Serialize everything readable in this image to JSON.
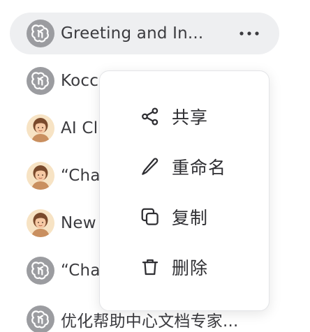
{
  "chats": [
    {
      "title": "Greeting and In...",
      "avatar": "chatgpt-logo-icon",
      "active": true
    },
    {
      "title": "Kocc",
      "avatar": "chatgpt-logo-icon",
      "active": false
    },
    {
      "title": "AI Cl",
      "avatar": "persona-avatar-icon",
      "active": false
    },
    {
      "title": "“Cha",
      "avatar": "persona-avatar-icon",
      "active": false
    },
    {
      "title": "New",
      "avatar": "persona-avatar-icon",
      "active": false
    },
    {
      "title": "“Cha",
      "avatar": "chatgpt-logo-icon",
      "active": false
    },
    {
      "title": "优化帮助中心文档专家...",
      "avatar": "chatgpt-logo-icon",
      "active": false
    }
  ],
  "more_icon": "ellipsis-icon",
  "context_menu": {
    "items": [
      {
        "label": "共享",
        "icon": "share-icon"
      },
      {
        "label": "重命名",
        "icon": "pencil-icon"
      },
      {
        "label": "复制",
        "icon": "copy-icon"
      },
      {
        "label": "删除",
        "icon": "trash-icon"
      }
    ]
  },
  "colors": {
    "active_row_bg": "#eeeff1",
    "gpt_avatar_bg": "#9b9ca0",
    "persona_avatar_bg": "#f7e3c4",
    "text": "#3b3b3f"
  }
}
